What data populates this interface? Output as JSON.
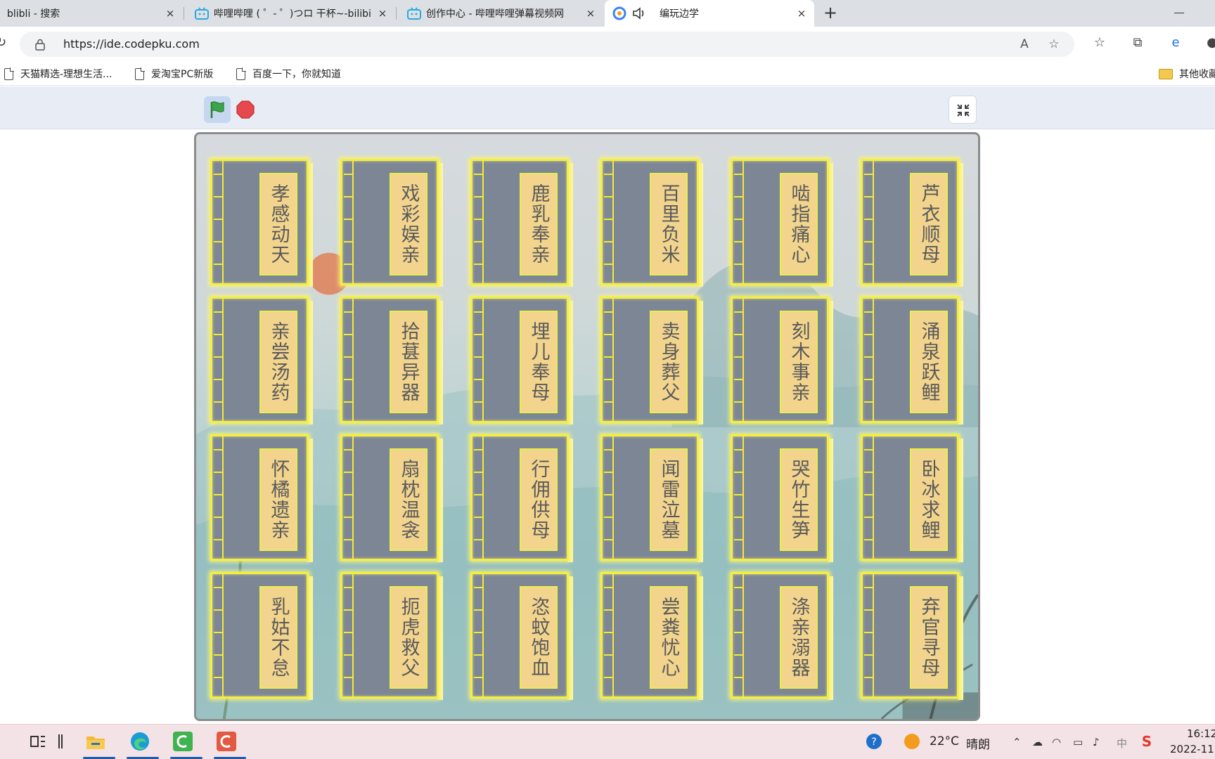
{
  "tabs": [
    {
      "title": "blibli - 搜索",
      "close": "×"
    },
    {
      "title": "哔哩哔哩 ( ゜- ゜)つロ 干杯~-bilibi",
      "close": "×"
    },
    {
      "title": "创作中心 - 哔哩哔哩弹幕视频网",
      "close": "×"
    },
    {
      "title": "编玩边学",
      "close": "×",
      "active": true
    }
  ],
  "new_tab": "+",
  "address": {
    "url": "https://ide.codepku.com"
  },
  "bookmarks": [
    {
      "label": "天猫精选-理想生活..."
    },
    {
      "label": "爱淘宝PC新版"
    },
    {
      "label": "百度一下，你就知道"
    }
  ],
  "other_bookmarks": "其他收藏",
  "stage": {
    "cards": [
      "孝感动天",
      "戏彩娱亲",
      "鹿乳奉亲",
      "百里负米",
      "啮指痛心",
      "芦衣顺母",
      "亲尝汤药",
      "拾葚异器",
      "埋儿奉母",
      "卖身葬父",
      "刻木事亲",
      "涌泉跃鲤",
      "怀橘遗亲",
      "扇枕温衾",
      "行佣供母",
      "闻雷泣墓",
      "哭竹生笋",
      "卧冰求鲤",
      "乳姑不怠",
      "扼虎救父",
      "恣蚊饱血",
      "尝粪忧心",
      "涤亲溺器",
      "弃官寻母"
    ],
    "columns": 6
  },
  "taskbar": {
    "weather_temp": "22°C",
    "weather_text": "晴朗",
    "ime": "中",
    "time": "16:12",
    "date": "2022-11"
  },
  "colors": {
    "card_border": "#f6ef3a",
    "card_body": "#7d8694",
    "title_slip": "#f2d48d",
    "flag_green": "#3aa54a",
    "stop_red": "#e5484d"
  }
}
